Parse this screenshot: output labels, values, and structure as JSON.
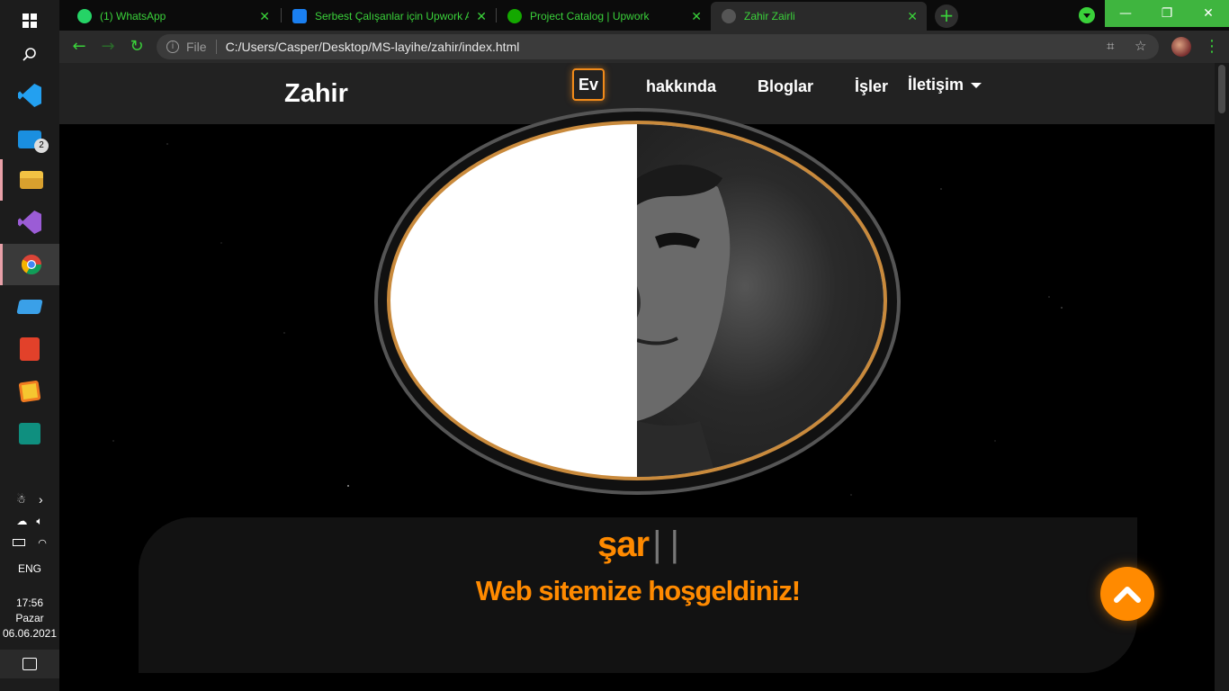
{
  "taskbar": {
    "apps": [
      {
        "name": "search-icon"
      },
      {
        "name": "vscode-icon",
        "color": "#23a0f0"
      },
      {
        "name": "mail-icon",
        "color": "#1a8fe0",
        "badge": "2"
      },
      {
        "name": "file-explorer-icon",
        "color": "#f2c243"
      },
      {
        "name": "visual-studio-icon",
        "color": "#9b5cd6"
      },
      {
        "name": "chrome-icon"
      },
      {
        "name": "laptop-icon",
        "color": "#3aa0e8"
      },
      {
        "name": "office-icon",
        "color": "#e2412a"
      },
      {
        "name": "sticky-app-icon",
        "color": "#f07a20"
      },
      {
        "name": "publisher-icon",
        "color": "#0f8f7f"
      }
    ],
    "tray": {
      "language": "ENG",
      "time": "17:56",
      "day": "Pazar",
      "date": "06.06.2021"
    }
  },
  "browser": {
    "tabs": [
      {
        "label": "(1) WhatsApp",
        "favicon_color": "#25d366"
      },
      {
        "label": "Serbest Çalışanlar için Upwork Ap",
        "favicon_color": "#1a7ff0"
      },
      {
        "label": "Project Catalog | Upwork",
        "favicon_color": "#14a800"
      },
      {
        "label": "Zahir Zairli",
        "favicon_color": "#555555"
      }
    ],
    "active_tab_index": 3,
    "address": {
      "scheme": "File",
      "url": "C:/Users/Casper/Desktop/MS-layihe/zahir/index.html"
    }
  },
  "site": {
    "brand": "Zahir",
    "nav": [
      "Ev",
      "hakkında",
      "Bloglar",
      "İşler",
      "İletişim"
    ],
    "active_nav": "Ev",
    "hero": {
      "typed_text": "şar",
      "cursor": "| |",
      "welcome": "Web sitemize hoşgeldiniz!"
    },
    "accent_color": "#ff8a00",
    "border_color": "#c98a3c"
  }
}
